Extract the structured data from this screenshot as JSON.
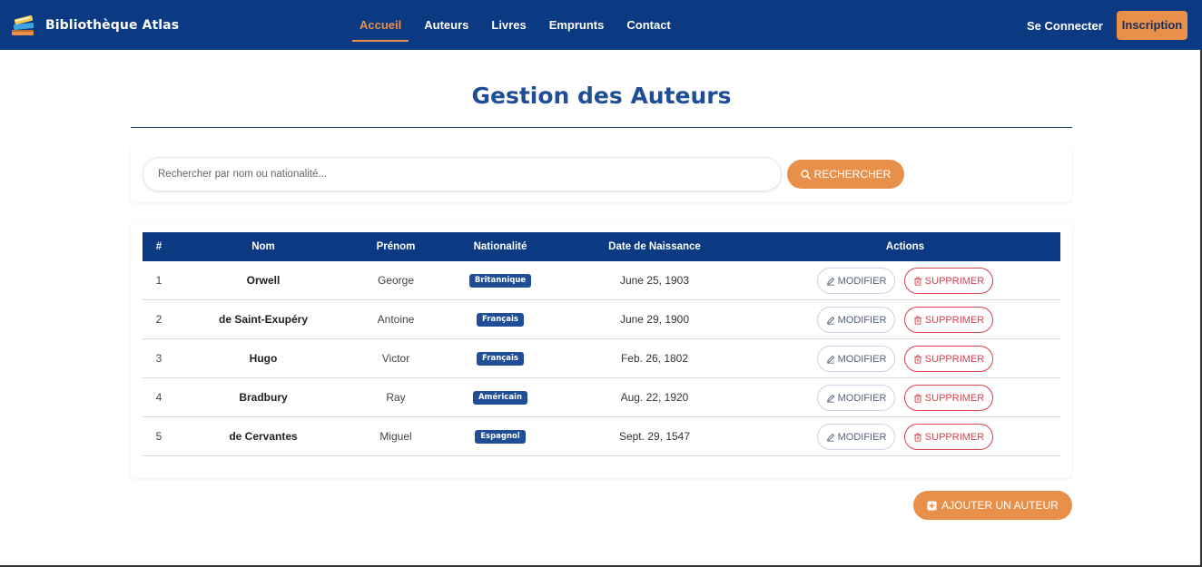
{
  "navbar": {
    "brand": "Bibliothèque Atlas",
    "logo_icon": "books-icon",
    "links": [
      {
        "label": "Accueil",
        "active": true
      },
      {
        "label": "Auteurs",
        "active": false
      },
      {
        "label": "Livres",
        "active": false
      },
      {
        "label": "Emprunts",
        "active": false
      },
      {
        "label": "Contact",
        "active": false
      }
    ],
    "login_label": "Se Connecter",
    "signup_label": "Inscription"
  },
  "page": {
    "title": "Gestion des Auteurs"
  },
  "search": {
    "placeholder": "Rechercher par nom ou nationalité...",
    "value": "",
    "button_label": "RECHERCHER",
    "button_icon": "search-icon"
  },
  "table": {
    "headers": {
      "num": "#",
      "nom": "Nom",
      "prenom": "Prénom",
      "nationalite": "Nationalité",
      "date": "Date de Naissance",
      "actions": "Actions"
    },
    "rows": [
      {
        "num": "1",
        "nom": "Orwell",
        "prenom": "George",
        "nationalite": "Britannique",
        "date": "June 25, 1903"
      },
      {
        "num": "2",
        "nom": "de Saint-Exupéry",
        "prenom": "Antoine",
        "nationalite": "Français",
        "date": "June 29, 1900"
      },
      {
        "num": "3",
        "nom": "Hugo",
        "prenom": "Victor",
        "nationalite": "Français",
        "date": "Feb. 26, 1802"
      },
      {
        "num": "4",
        "nom": "Bradbury",
        "prenom": "Ray",
        "nationalite": "Américain",
        "date": "Aug. 22, 1920"
      },
      {
        "num": "5",
        "nom": "de Cervantes",
        "prenom": "Miguel",
        "nationalite": "Espagnol",
        "date": "Sept. 29, 1547"
      }
    ],
    "edit_label": "MODIFIER",
    "delete_label": "SUPPRIMER"
  },
  "add_button": {
    "label": "AJOUTER UN AUTEUR",
    "icon": "plus-square-icon"
  },
  "colors": {
    "navbar": "#0b3a82",
    "accent": "#e8904a",
    "title": "#1f4e96",
    "badge": "#1f4e96",
    "danger": "#d9414f"
  }
}
